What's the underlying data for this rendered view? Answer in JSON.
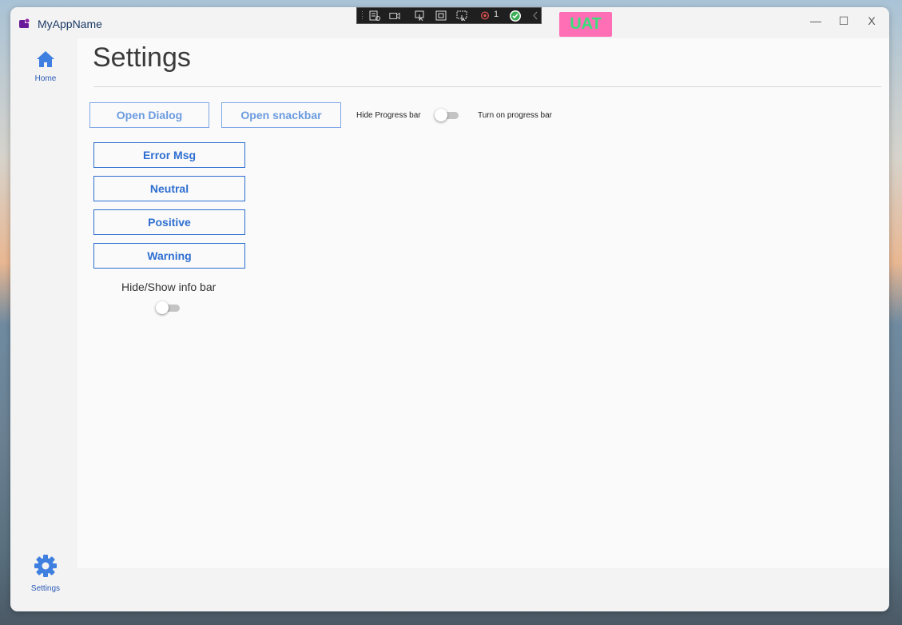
{
  "app": {
    "title": "MyAppName",
    "accent_color": "#2e6fd1",
    "logo_icon": "app-logo-icon"
  },
  "window_controls": {
    "minimize": "—",
    "maximize": "☐",
    "close": "X"
  },
  "sidebar": {
    "items": [
      {
        "label": "Home",
        "icon": "home-icon"
      },
      {
        "label": "Settings",
        "icon": "gear-icon"
      }
    ]
  },
  "page": {
    "title": "Settings"
  },
  "actions": {
    "open_dialog": "Open Dialog",
    "open_snackbar": "Open snackbar",
    "hide_progress_label": "Hide Progress bar",
    "turn_on_progress_label": "Turn on progress bar",
    "progress_toggle_on": false
  },
  "info_buttons": [
    "Error Msg",
    "Neutral",
    "Positive",
    "Warning"
  ],
  "info_bar": {
    "label": "Hide/Show info bar",
    "toggle_on": false
  },
  "debug_toolbar": {
    "hot_reload_count": "1"
  },
  "env_badge": {
    "label": "UAT",
    "bg": "#ff6fb5",
    "fg": "#35e07a"
  }
}
